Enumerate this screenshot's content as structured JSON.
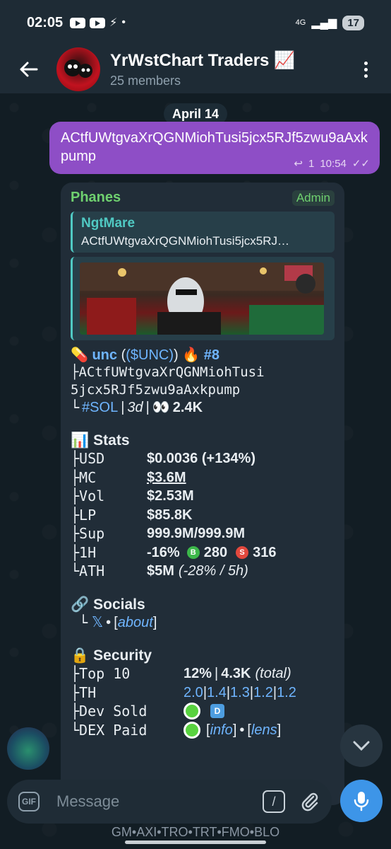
{
  "status": {
    "time": "02:05",
    "network": "4G",
    "battery": "17"
  },
  "header": {
    "title": "YrWstChart Traders 📈",
    "subtitle": "25 members"
  },
  "date_chip": "April 14",
  "outgoing": {
    "text": "ACtfUWtgvaXrQGNMiohTusi5jcx5RJf5zwu9aAxkpump",
    "replies": "1",
    "time": "10:54"
  },
  "incoming": {
    "sender": "Phanes",
    "badge": "Admin",
    "reply_name": "NgtMare",
    "reply_text": "ACtfUWtgvaXrQGNMiohTusi5jcx5RJ…",
    "token_name": "unc",
    "token_ticker": "($UNC)",
    "rank": "#8",
    "address_line1": "ACtfUWtgvaXrQGNMiohTusi",
    "address_line2": "5jcx5RJf5zwu9aAxkpump",
    "chain": "#SOL",
    "age": "3d",
    "views": "2.4K",
    "stats_title": "Stats",
    "stats": [
      {
        "label": "USD",
        "value": "$0.0036 (+134%)"
      },
      {
        "label": "MC",
        "value": "$3.6M"
      },
      {
        "label": "Vol",
        "value": "$2.53M"
      },
      {
        "label": "LP",
        "value": "$85.8K"
      },
      {
        "label": "Sup",
        "value": "999.9M/999.9M"
      }
    ],
    "h1_label": "1H",
    "h1_change": "-16%",
    "buys": "280",
    "sells": "316",
    "ath_label": "ATH",
    "ath_value": "$5M",
    "ath_note": "(-28% / 5h)",
    "socials_title": "Socials",
    "socials_x": "𝕏",
    "socials_about": "about",
    "security_title": "Security",
    "top10_label": "Top 10",
    "top10_value": "12%",
    "top10_holders": "4.3K",
    "top10_note": "(total)",
    "th_label": "TH",
    "th_values": [
      "2.0",
      "1.4",
      "1.3",
      "1.2",
      "1.2"
    ],
    "dev_label": "Dev Sold",
    "dex_label": "DEX Paid",
    "info_link": "info",
    "lens_link": "lens"
  },
  "input": {
    "placeholder": "Message",
    "gif_label": "GIF"
  },
  "bottom_strip": "GM•AXI•TRO•TRT•FMO•BLO"
}
